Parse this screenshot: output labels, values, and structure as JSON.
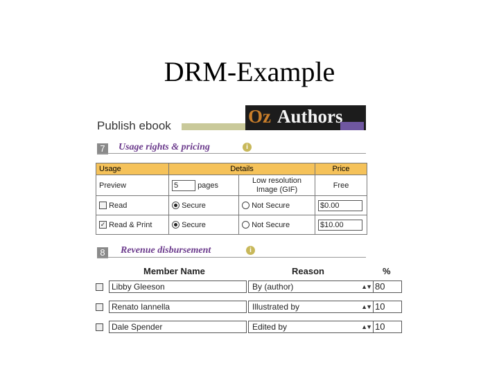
{
  "slide_title": "DRM-Example",
  "page_title": "Publish ebook",
  "logo": {
    "oz": "Oz",
    "authors": "Authors"
  },
  "usage_section": {
    "number": "7",
    "title": "Usage rights & pricing",
    "info_icon": "i",
    "columns": [
      "Usage",
      "Details",
      "Price"
    ],
    "preview": {
      "label": "Preview",
      "pages_value": "5",
      "pages_unit": "pages",
      "detail": "Low resolution Image (GIF)",
      "price": "Free"
    },
    "rows": [
      {
        "checked": false,
        "label": "Read",
        "secure": "Secure",
        "not_secure": "Not Secure",
        "secure_selected": true,
        "price": "$0.00"
      },
      {
        "checked": true,
        "label": "Read & Print",
        "secure": "Secure",
        "not_secure": "Not Secure",
        "secure_selected": true,
        "price": "$10.00"
      }
    ]
  },
  "revenue_section": {
    "number": "8",
    "title": "Revenue disbursement",
    "info_icon": "i",
    "columns": [
      "Member Name",
      "Reason",
      "%"
    ],
    "rows": [
      {
        "name": "Libby Gleeson",
        "reason": "By (author)",
        "percent": "80"
      },
      {
        "name": "Renato Iannella",
        "reason": "Illustrated by",
        "percent": "10"
      },
      {
        "name": "Dale Spender",
        "reason": "Edited by",
        "percent": "10"
      }
    ]
  },
  "icons": {
    "select_arrow": "up-down-arrow-icon"
  }
}
